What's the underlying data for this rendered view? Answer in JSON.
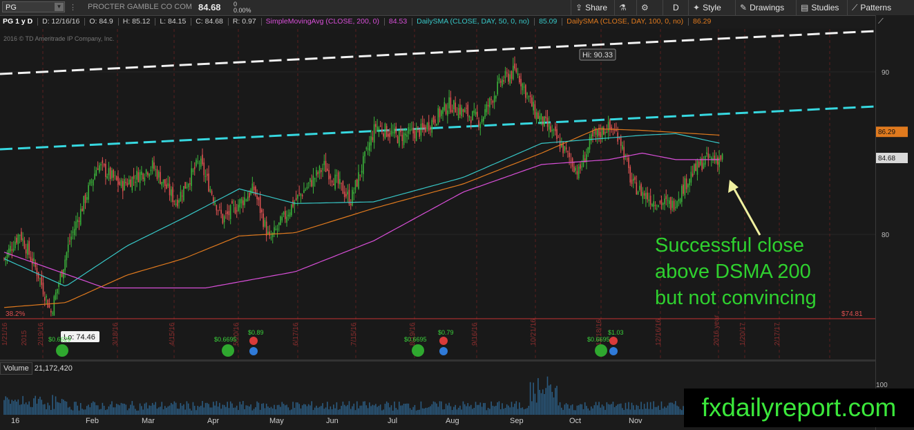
{
  "toolbar": {
    "symbol": "PG",
    "company": "PROCTER GAMBLE CO COM",
    "last": "84.68",
    "change_top": "0",
    "change_bottom": "0.00%",
    "share": "Share",
    "d_label": "D",
    "style": "Style",
    "drawings": "Drawings",
    "studies": "Studies",
    "patterns": "Patterns"
  },
  "info": {
    "title": "PG 1 y D",
    "date": "D: 12/16/16",
    "open": "O: 84.9",
    "high": "H: 85.12",
    "low": "L: 84.15",
    "close": "C: 84.68",
    "range": "R: 0.97",
    "sma200_label": "SimpleMovingAvg (CLOSE, 200, 0)",
    "sma200_val": "84.53",
    "sma50_label": "DailySMA (CLOSE, DAY, 50, 0, no)",
    "sma50_val": "85.09",
    "sma100_label": "DailySMA (CLOSE, DAY, 100, 0, no)",
    "sma100_val": "86.29",
    "copyright": "2016 © TD Ameritrade IP Company, Inc."
  },
  "colors": {
    "sma200": "#d94fd9",
    "sma50": "#37c8c8",
    "sma100": "#e07a1e",
    "up": "#3bb33b",
    "down": "#e05252",
    "annotation": "#2fd12f"
  },
  "annotation": {
    "line1": "Successful close",
    "line2": "above DSMA 200",
    "line3": "but not convincing"
  },
  "brand": "fxdailyreport.com",
  "volume": {
    "label": "Volume",
    "value": "21,172,420",
    "axis_tick": "100"
  },
  "chart_data": {
    "type": "candlestick",
    "ylim": [
      73.5,
      92.5
    ],
    "yticks": [
      "90",
      "80"
    ],
    "price_labels": {
      "sma100": "86.29",
      "last": "84.68",
      "fib": "$74.81"
    },
    "hi_label": "Hi: 90.33",
    "lo_label": "Lo: 74.46",
    "fib_label": "38.2%",
    "months": [
      "16",
      "Feb",
      "Mar",
      "Apr",
      "May",
      "Jun",
      "Jul",
      "Aug",
      "Sep",
      "Oct",
      "Nov"
    ],
    "date_markers": [
      "1/21/16",
      "2015",
      "2/19/16",
      "3/18/16",
      "4/15/16",
      "5/20/16",
      "6/17/16",
      "7/15/16",
      "8/19/16",
      "9/16/16",
      "10/21/16",
      "11/18/16",
      "12/16/16",
      "2016 year",
      "1/20/17",
      "2/17/17"
    ],
    "dividends": [
      "$0.6629",
      "$0.6695",
      "$0.6695",
      "$0.6695"
    ],
    "earnings": [
      "$0.89",
      "$0.79",
      "$1.03"
    ],
    "close_anchors": [
      [
        0,
        78.5
      ],
      [
        10,
        80.1
      ],
      [
        22,
        77.5
      ],
      [
        30,
        75.2
      ],
      [
        42,
        79.6
      ],
      [
        60,
        84.3
      ],
      [
        75,
        83.0
      ],
      [
        95,
        84.2
      ],
      [
        110,
        82.0
      ],
      [
        125,
        84.5
      ],
      [
        140,
        80.9
      ],
      [
        160,
        82.8
      ],
      [
        170,
        79.6
      ],
      [
        185,
        81.9
      ],
      [
        205,
        84.2
      ],
      [
        222,
        82.1
      ],
      [
        238,
        86.7
      ],
      [
        252,
        86.0
      ],
      [
        268,
        86.4
      ],
      [
        285,
        88.0
      ],
      [
        305,
        87.0
      ],
      [
        318,
        89.4
      ],
      [
        328,
        90.1
      ],
      [
        340,
        87.5
      ],
      [
        350,
        86.4
      ],
      [
        360,
        85.0
      ],
      [
        368,
        83.8
      ],
      [
        376,
        85.8
      ],
      [
        386,
        86.6
      ],
      [
        394,
        86.1
      ],
      [
        402,
        83.1
      ],
      [
        415,
        82.1
      ],
      [
        428,
        81.8
      ],
      [
        440,
        83.7
      ],
      [
        449,
        84.6
      ],
      [
        460,
        84.7
      ]
    ],
    "sma200_anchors": [
      [
        0,
        78.9
      ],
      [
        90,
        76.7
      ],
      [
        180,
        76.7
      ],
      [
        260,
        77.7
      ],
      [
        330,
        79.6
      ],
      [
        410,
        82.6
      ],
      [
        480,
        84.3
      ],
      [
        540,
        84.6
      ],
      [
        570,
        85.0
      ],
      [
        600,
        84.6
      ],
      [
        640,
        84.6
      ]
    ],
    "sma50_anchors": [
      [
        0,
        78.5
      ],
      [
        55,
        76.8
      ],
      [
        110,
        79.3
      ],
      [
        160,
        81.0
      ],
      [
        210,
        82.8
      ],
      [
        260,
        81.9
      ],
      [
        330,
        82.0
      ],
      [
        410,
        83.5
      ],
      [
        480,
        85.6
      ],
      [
        570,
        86.1
      ],
      [
        600,
        86.2
      ],
      [
        640,
        85.6
      ]
    ],
    "sma100_anchors": [
      [
        0,
        75.5
      ],
      [
        55,
        75.8
      ],
      [
        110,
        77.5
      ],
      [
        160,
        78.5
      ],
      [
        210,
        79.9
      ],
      [
        260,
        80.1
      ],
      [
        330,
        81.6
      ],
      [
        410,
        83.1
      ],
      [
        480,
        85.0
      ],
      [
        530,
        86.5
      ],
      [
        570,
        86.4
      ],
      [
        640,
        86.1
      ]
    ]
  }
}
